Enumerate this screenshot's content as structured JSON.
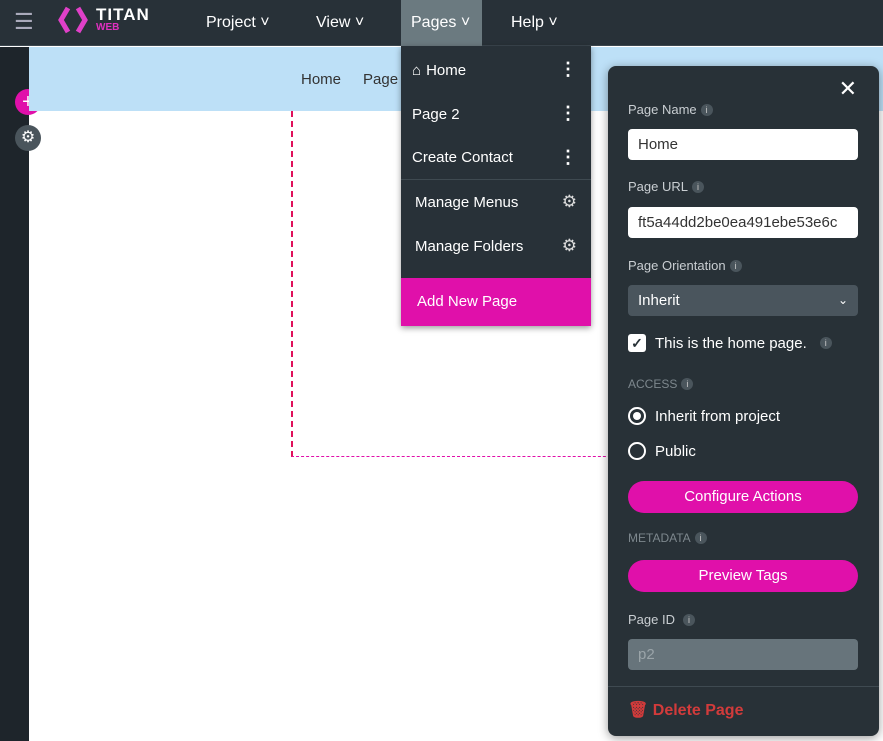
{
  "app": {
    "logo_title": "TITAN",
    "logo_sub": "WEB"
  },
  "menu": [
    "Project",
    "View",
    "Pages",
    "Help"
  ],
  "canvas": {
    "nav": [
      "Home",
      "Page"
    ]
  },
  "pages_dropdown": {
    "items": [
      "Home",
      "Page 2",
      "Create Contact"
    ],
    "manage": [
      "Manage Menus",
      "Manage Folders"
    ],
    "add": "Add New Page"
  },
  "panel": {
    "page_name_label": "Page Name",
    "page_name": "Home",
    "page_url_label": "Page URL",
    "page_url": "ft5a44dd2be0ea491ebe53e6c",
    "orientation_label": "Page Orientation",
    "orientation": "Inherit",
    "home_check": "This is the home page.",
    "home_checked": true,
    "access_label": "ACCESS",
    "access_options": [
      "Inherit from project",
      "Public"
    ],
    "access_selected": "Inherit from project",
    "configure": "Configure Actions",
    "metadata_label": "METADATA",
    "preview": "Preview Tags",
    "page_id_label": "Page ID",
    "page_id": "p2",
    "delete": "Delete Page"
  },
  "colors": {
    "accent": "#e010aa",
    "topbar": "#283138",
    "danger": "#d23b3b"
  }
}
